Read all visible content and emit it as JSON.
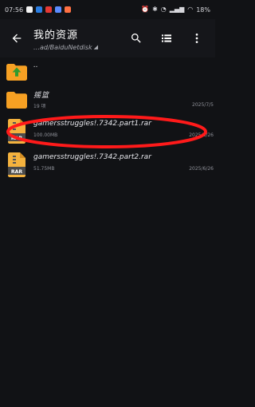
{
  "status_bar": {
    "time": "07:56",
    "battery": "18%"
  },
  "app_bar": {
    "title": "我的资源",
    "path": "…ad/BaiduNetdisk",
    "back_icon": "arrow-left-icon",
    "search_icon": "search-icon",
    "list_view_icon": "list-view-icon",
    "more_icon": "more-vertical-icon"
  },
  "files": [
    {
      "type": "parent",
      "name": "..",
      "meta": "",
      "date": ""
    },
    {
      "type": "folder",
      "name": "摇篮",
      "meta": "19 项",
      "date": "2025/7/5"
    },
    {
      "type": "rar",
      "name": "gamersstruggles!.7342.part1.rar",
      "meta": "100.00MB",
      "date": "2025/6/26"
    },
    {
      "type": "rar",
      "name": "gamersstruggles!.7342.part2.rar",
      "meta": "51.75MB",
      "date": "2025/6/26"
    }
  ],
  "colors": {
    "background": "#111215",
    "appbar": "#15161a",
    "folder": "#f6a023",
    "parent_arrow": "#2f9a2f",
    "rar_body": "#f4b23e",
    "rar_band": "#4b4b4b",
    "annotation": "#ff1a1a"
  }
}
